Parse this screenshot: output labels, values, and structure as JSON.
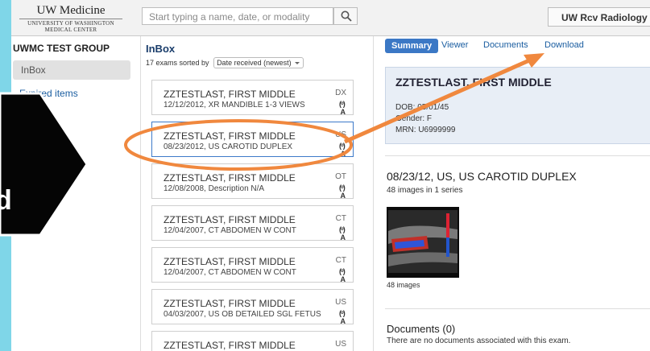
{
  "logo": {
    "title": "UW Medicine",
    "subtitle_1": "UNIVERSITY OF WASHINGTON",
    "subtitle_2": "MEDICAL CENTER"
  },
  "search": {
    "placeholder": "Start typing a name, date, or modality",
    "icon": "search-icon"
  },
  "user_button": "UW Rcv Radiology",
  "sidebar": {
    "group_title": "UWMC TEST GROUP",
    "items": [
      {
        "label": "InBox"
      },
      {
        "label": "Expired items"
      }
    ]
  },
  "inbox": {
    "title": "InBox",
    "sort_prefix": "17 exams sorted by",
    "sort_value": "Date received (newest)",
    "items": [
      {
        "name": "ZZTESTLAST, FIRST MIDDLE",
        "detail": "12/12/2012, XR MANDIBLE 1-3 VIEWS",
        "modality": "DX"
      },
      {
        "name": "ZZTESTLAST, FIRST MIDDLE",
        "detail": "08/23/2012, US CAROTID DUPLEX",
        "modality": "US"
      },
      {
        "name": "ZZTESTLAST, FIRST MIDDLE",
        "detail": "12/08/2008, Description N/A",
        "modality": "OT"
      },
      {
        "name": "ZZTESTLAST, FIRST MIDDLE",
        "detail": "12/04/2007, CT ABDOMEN W CONT",
        "modality": "CT"
      },
      {
        "name": "ZZTESTLAST, FIRST MIDDLE",
        "detail": "12/04/2007, CT ABDOMEN W CONT",
        "modality": "CT"
      },
      {
        "name": "ZZTESTLAST, FIRST MIDDLE",
        "detail": "04/03/2007, US OB DETAILED SGL FETUS",
        "modality": "US"
      },
      {
        "name": "ZZTESTLAST, FIRST MIDDLE",
        "detail": "",
        "modality": "US"
      }
    ],
    "item_icon_glyph": "(•)\nA",
    "selected_index": 1
  },
  "tabs": [
    {
      "label": "Summary",
      "active": true
    },
    {
      "label": "Viewer"
    },
    {
      "label": "Documents"
    },
    {
      "label": "Download"
    }
  ],
  "patient": {
    "name": "ZZTESTLAST, FIRST MIDDLE",
    "dob": "DOB: 05/01/45",
    "gender": "Gender: F",
    "mrn": "MRN: U6999999"
  },
  "study": {
    "title": "08/23/12, US, US CAROTID DUPLEX",
    "subtitle": "48 images in 1 series",
    "thumb_caption": "48 images"
  },
  "documents": {
    "title": "Documents (0)",
    "text": "There are no documents associated with this exam."
  },
  "overlay": {
    "big_text": "d",
    "accent_color": "#f0883e",
    "background_color": "#7fd6e8"
  }
}
